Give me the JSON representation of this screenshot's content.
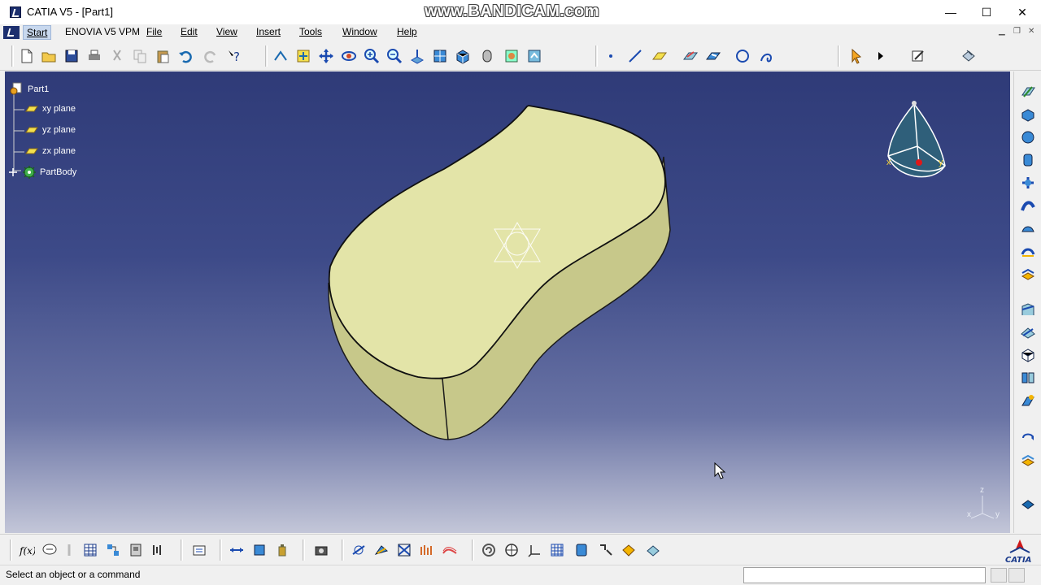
{
  "window": {
    "title": "CATIA V5 - [Part1]",
    "watermark": "www.BANDICAM.com",
    "minimize_glyph": "—",
    "maximize_glyph": "☐",
    "close_glyph": "✕"
  },
  "menu": {
    "start": "Start",
    "enovia": "ENOVIA V5 VPM",
    "file": "File",
    "edit": "Edit",
    "view": "View",
    "insert": "Insert",
    "tools": "Tools",
    "window": "Window",
    "help": "Help"
  },
  "tree": {
    "root": "Part1",
    "items": [
      "xy plane",
      "yz plane",
      "zx plane",
      "PartBody"
    ]
  },
  "compass": {
    "x_label": "x",
    "y_label": "y"
  },
  "axis_triad": {
    "x": "x",
    "y": "y",
    "z": "z"
  },
  "status": {
    "message": "Select an object or a command",
    "command_value": ""
  },
  "brand": {
    "logo_text": "CATIA"
  },
  "colors": {
    "part_top": "#e2e4a6",
    "part_side": "#c9c98a",
    "viewport_top": "#2f3b78",
    "viewport_bottom": "#c3c6d8"
  }
}
